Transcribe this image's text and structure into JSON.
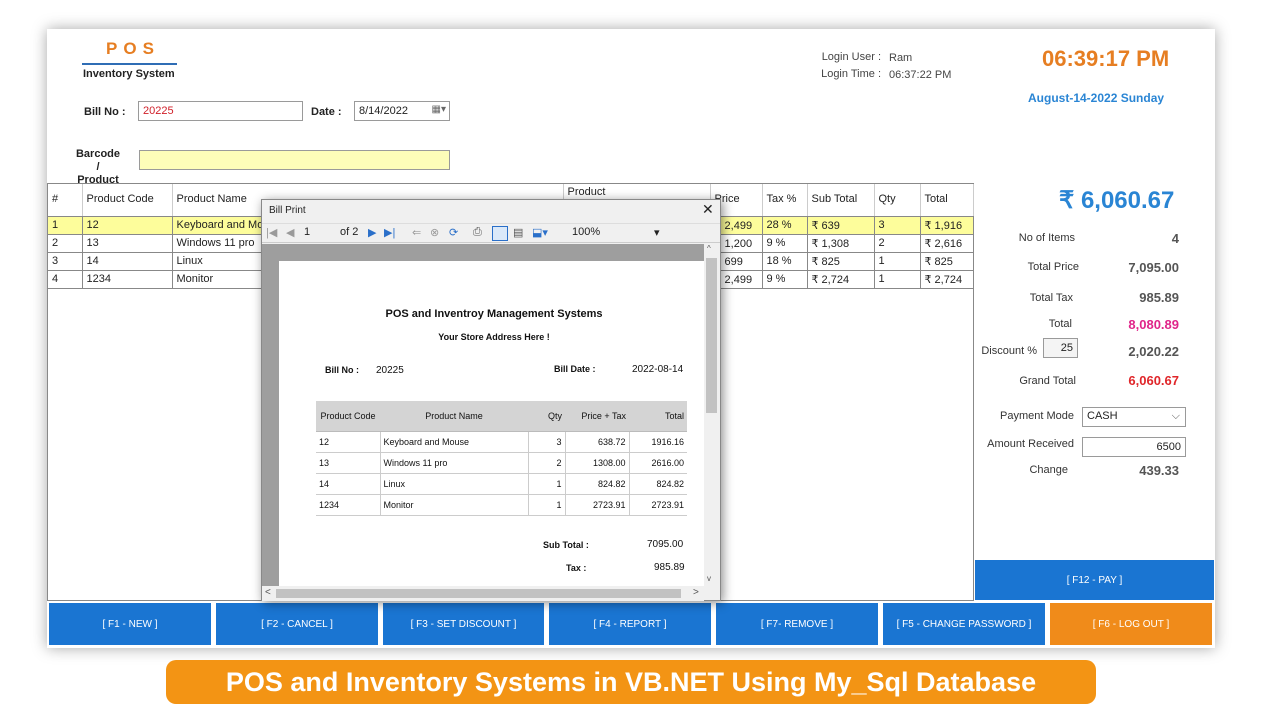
{
  "header": {
    "logo": "POS",
    "logo_subtitle": "Inventory System",
    "bill_no_label": "Bill No :",
    "bill_no_value": "20225",
    "date_label": "Date :",
    "date_value": "8/14/2022",
    "barcode_label_1": "Barcode /",
    "barcode_label_2": "Product",
    "barcode_value": "",
    "login_user_label": "Login User :",
    "login_user_value": "Ram",
    "login_time_label": "Login Time :",
    "login_time_value": "06:37:22 PM",
    "clock": "06:39:17 PM",
    "date_full": "August-14-2022  Sunday"
  },
  "grid": {
    "columns": [
      "#",
      "Product Code",
      "Product Name",
      "Product",
      "Price",
      "Tax %",
      "Sub Total",
      "Qty",
      "Total"
    ],
    "rows": [
      {
        "n": "1",
        "code": "12",
        "name": "Keyboard and Mouse",
        "price": "₹ 2,499",
        "tax": "28 %",
        "sub": "₹ 639",
        "qty": "3",
        "total": "₹ 1,916"
      },
      {
        "n": "2",
        "code": "13",
        "name": "Windows 11 pro",
        "price": "₹ 1,200",
        "tax": "9 %",
        "sub": "₹ 1,308",
        "qty": "2",
        "total": "₹ 2,616"
      },
      {
        "n": "3",
        "code": "14",
        "name": "Linux",
        "price": "₹ 699",
        "tax": "18 %",
        "sub": "₹ 825",
        "qty": "1",
        "total": "₹ 825"
      },
      {
        "n": "4",
        "code": "1234",
        "name": "Monitor",
        "price": "₹ 2,499",
        "tax": "9 %",
        "sub": "₹ 2,724",
        "qty": "1",
        "total": "₹ 2,724"
      }
    ]
  },
  "summary": {
    "grand_total_big": "₹ 6,060.67",
    "no_of_items_label": "No of Items",
    "no_of_items": "4",
    "total_price_label": "Total Price",
    "total_price": "7,095.00",
    "total_tax_label": "Total Tax",
    "total_tax": "985.89",
    "total_label": "Total",
    "total": "8,080.89",
    "discount_label": "Discount %",
    "discount_pct": "25",
    "discount_amount": "2,020.22",
    "grand_total_label": "Grand Total",
    "grand_total": "6,060.67",
    "payment_mode_label": "Payment Mode",
    "payment_mode": "CASH",
    "amount_received_label": "Amount Received",
    "amount_received": "6500",
    "change_label": "Change",
    "change": "439.33"
  },
  "buttons": {
    "pay": "[ F12 - PAY ]",
    "new": "[ F1 - NEW ]",
    "cancel": "[ F2 - CANCEL ]",
    "discount": "[ F3 - SET DISCOUNT ]",
    "report": "[ F4 - REPORT  ]",
    "remove": "[ F7- REMOVE ]",
    "change_password": "[ F5 - CHANGE PASSWORD  ]",
    "logout": "[ F6 - LOG OUT  ]"
  },
  "dialog": {
    "title": "Bill Print",
    "page_current": "1",
    "page_of": "of 2",
    "zoom": "100%",
    "report": {
      "title": "POS and Inventroy Management Systems",
      "address": "Your Store Address Here !",
      "bill_no_label": "Bill No :",
      "bill_no": "20225",
      "bill_date_label": "Bill Date :",
      "bill_date": "2022-08-14",
      "columns": [
        "Product Code",
        "Product Name",
        "Qty",
        "Price +  Tax",
        "Total"
      ],
      "rows": [
        {
          "code": "12",
          "name": "Keyboard and Mouse",
          "qty": "3",
          "price": "638.72",
          "total": "1916.16"
        },
        {
          "code": "13",
          "name": "Windows 11 pro",
          "qty": "2",
          "price": "1308.00",
          "total": "2616.00"
        },
        {
          "code": "14",
          "name": "Linux",
          "qty": "1",
          "price": "824.82",
          "total": "824.82"
        },
        {
          "code": "1234",
          "name": "Monitor",
          "qty": "1",
          "price": "2723.91",
          "total": "2723.91"
        }
      ],
      "subtotal_label": "Sub Total :",
      "subtotal": "7095.00",
      "tax_label": "Tax :",
      "tax": "985.89"
    }
  },
  "banner": "POS and Inventory Systems in VB.NET Using My_Sql Database"
}
